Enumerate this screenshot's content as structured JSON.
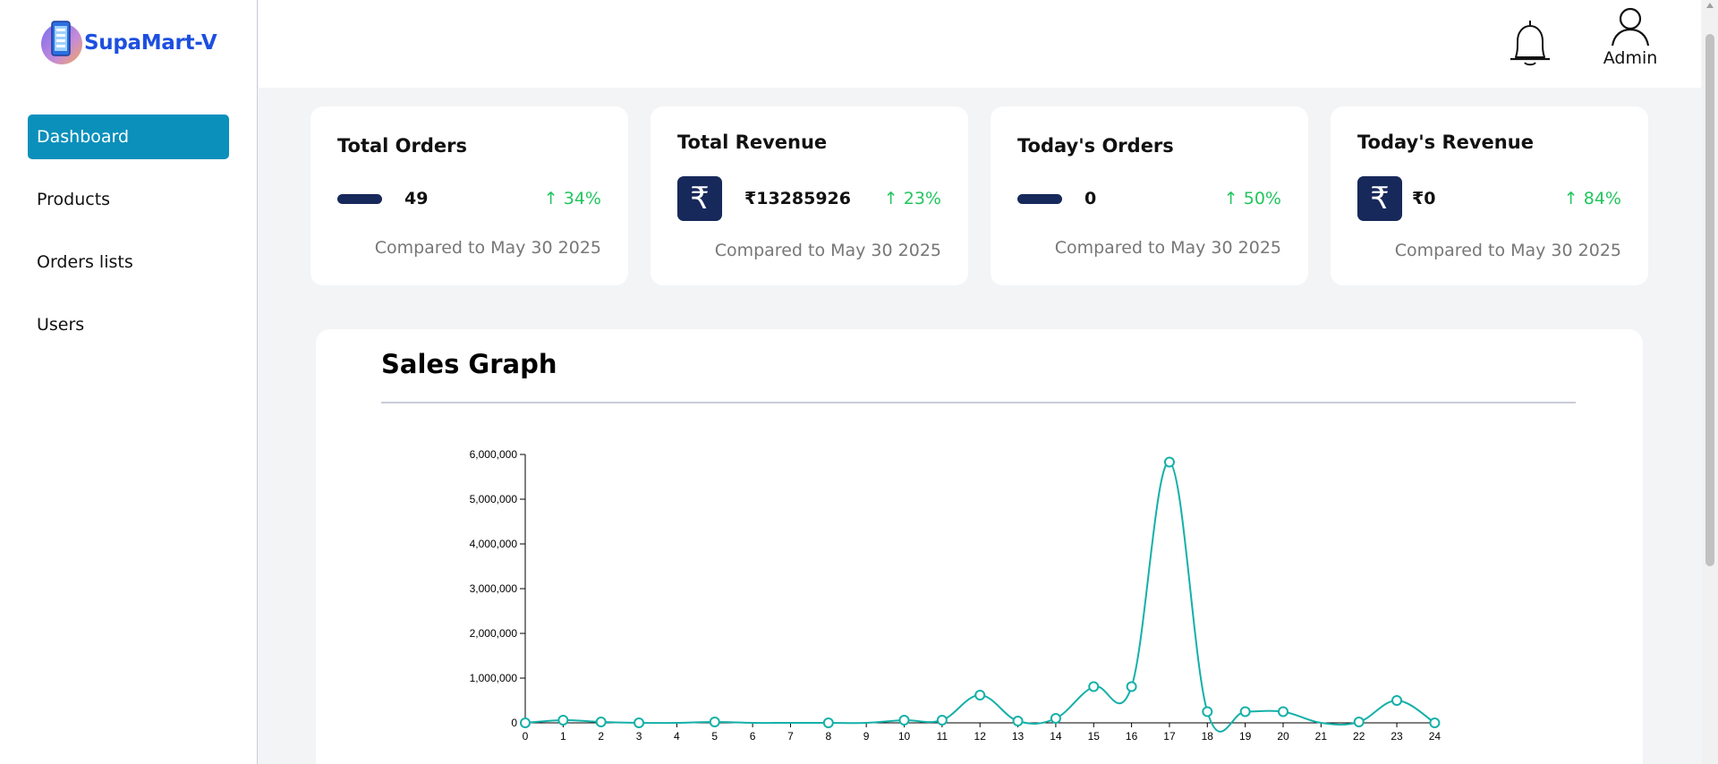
{
  "brand": {
    "name": "SupaMart-V",
    "logo_icon": "phone-logo-icon"
  },
  "nav": {
    "items": [
      {
        "label": "Dashboard",
        "active": true
      },
      {
        "label": "Products",
        "active": false
      },
      {
        "label": "Orders lists",
        "active": false
      },
      {
        "label": "Users",
        "active": false
      }
    ]
  },
  "header": {
    "notification_icon": "bell-icon",
    "user_icon": "user-icon",
    "user_label": "Admin"
  },
  "cards": [
    {
      "title": "Total Orders",
      "icon": "pill-icon",
      "value": "49",
      "change": "↑ 34%",
      "compare": "Compared to May 30 2025"
    },
    {
      "title": "Total Revenue",
      "icon": "rupee-icon",
      "icon_glyph": "₹",
      "value": "₹13285926",
      "change": "↑ 23%",
      "compare": "Compared to May 30 2025"
    },
    {
      "title": "Today's Orders",
      "icon": "pill-icon",
      "value": "0",
      "change": "↑ 50%",
      "compare": "Compared to May 30 2025"
    },
    {
      "title": "Today's Revenue",
      "icon": "rupee-icon",
      "icon_glyph": "₹",
      "value": "₹0",
      "change": "↑ 84%",
      "compare": "Compared to May 30 2025"
    }
  ],
  "colors": {
    "accent": "#0b90bb",
    "navy": "#17285a",
    "positive": "#22c55e",
    "line": "#14b0a8",
    "brand": "#1d4fe0"
  },
  "graph": {
    "title": "Sales Graph"
  },
  "chart_data": {
    "type": "line",
    "title": "Sales Graph",
    "xlabel": "",
    "ylabel": "",
    "x": [
      0,
      1,
      2,
      3,
      4,
      5,
      6,
      7,
      8,
      9,
      10,
      11,
      12,
      13,
      14,
      15,
      16,
      17,
      18,
      19,
      20,
      21,
      22,
      23,
      24
    ],
    "series": [
      {
        "values": [
          0,
          60000,
          20000,
          0,
          null,
          20000,
          null,
          null,
          0,
          null,
          60000,
          60000,
          620000,
          40000,
          100000,
          810000,
          810000,
          5830000,
          250000,
          250000,
          250000,
          null,
          20000,
          500000,
          0
        ]
      }
    ],
    "ylim": [
      0,
      6000000
    ],
    "yticks": [
      "0",
      "1,000,000",
      "2,000,000",
      "3,000,000",
      "4,000,000",
      "5,000,000",
      "6,000,000"
    ],
    "xticks": [
      "0",
      "1",
      "2",
      "3",
      "4",
      "5",
      "6",
      "7",
      "8",
      "9",
      "10",
      "11",
      "12",
      "13",
      "14",
      "15",
      "16",
      "17",
      "18",
      "19",
      "20",
      "21",
      "22",
      "23",
      "24"
    ],
    "grid": false,
    "legend": "none",
    "markers": "hollow-circle"
  }
}
